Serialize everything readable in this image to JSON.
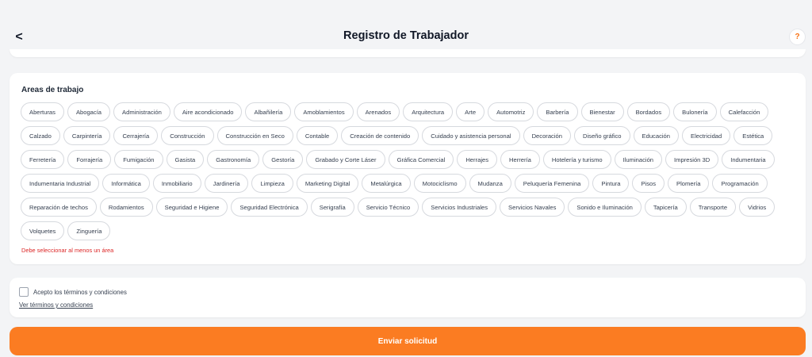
{
  "header": {
    "back_label": "<",
    "title": "Registro de Trabajador",
    "help_label": "?"
  },
  "areas": {
    "title": "Areas de trabajo",
    "chips": [
      "Aberturas",
      "Abogacía",
      "Administración",
      "Aire acondicionado",
      "Albañilería",
      "Amoblamientos",
      "Arenados",
      "Arquitectura",
      "Arte",
      "Automotriz",
      "Barbería",
      "Bienestar",
      "Bordados",
      "Bulonería",
      "Calefacción",
      "Calzado",
      "Carpintería",
      "Cerrajería",
      "Construcción",
      "Construcción en Seco",
      "Contable",
      "Creación de contenido",
      "Cuidado y asistencia personal",
      "Decoración",
      "Diseño gráfico",
      "Educación",
      "Electricidad",
      "Estética",
      "Ferretería",
      "Forrajería",
      "Fumigación",
      "Gasista",
      "Gastronomía",
      "Gestoría",
      "Grabado y Corte Láser",
      "Gráfica Comercial",
      "Herrajes",
      "Herrería",
      "Hotelería y turismo",
      "Iluminación",
      "Impresión 3D",
      "Indumentaria",
      "Indumentaria Industrial",
      "Informática",
      "Inmobiliario",
      "Jardinería",
      "Limpieza",
      "Marketing Digital",
      "Metalúrgica",
      "Motociclismo",
      "Mudanza",
      "Peluquería Femenina",
      "Pintura",
      "Pisos",
      "Plomería",
      "Programación",
      "Reparación de techos",
      "Rodamientos",
      "Seguridad e Higiene",
      "Seguridad Electrónica",
      "Serigrafía",
      "Servicio Técnico",
      "Servicios Industriales",
      "Servicios Navales",
      "Sonido e Iluminación",
      "Tapicería",
      "Transporte",
      "Vidrios",
      "Volquetes",
      "Zinguería"
    ],
    "error": "Debe seleccionar al menos un área"
  },
  "terms": {
    "accept_label": "Acepto los términos y condiciones",
    "accepted": false,
    "link_label": "Ver términos y condiciones"
  },
  "submit": {
    "label": "Enviar solicitud"
  },
  "colors": {
    "accent": "#fb7c22",
    "error": "#dc2626"
  }
}
